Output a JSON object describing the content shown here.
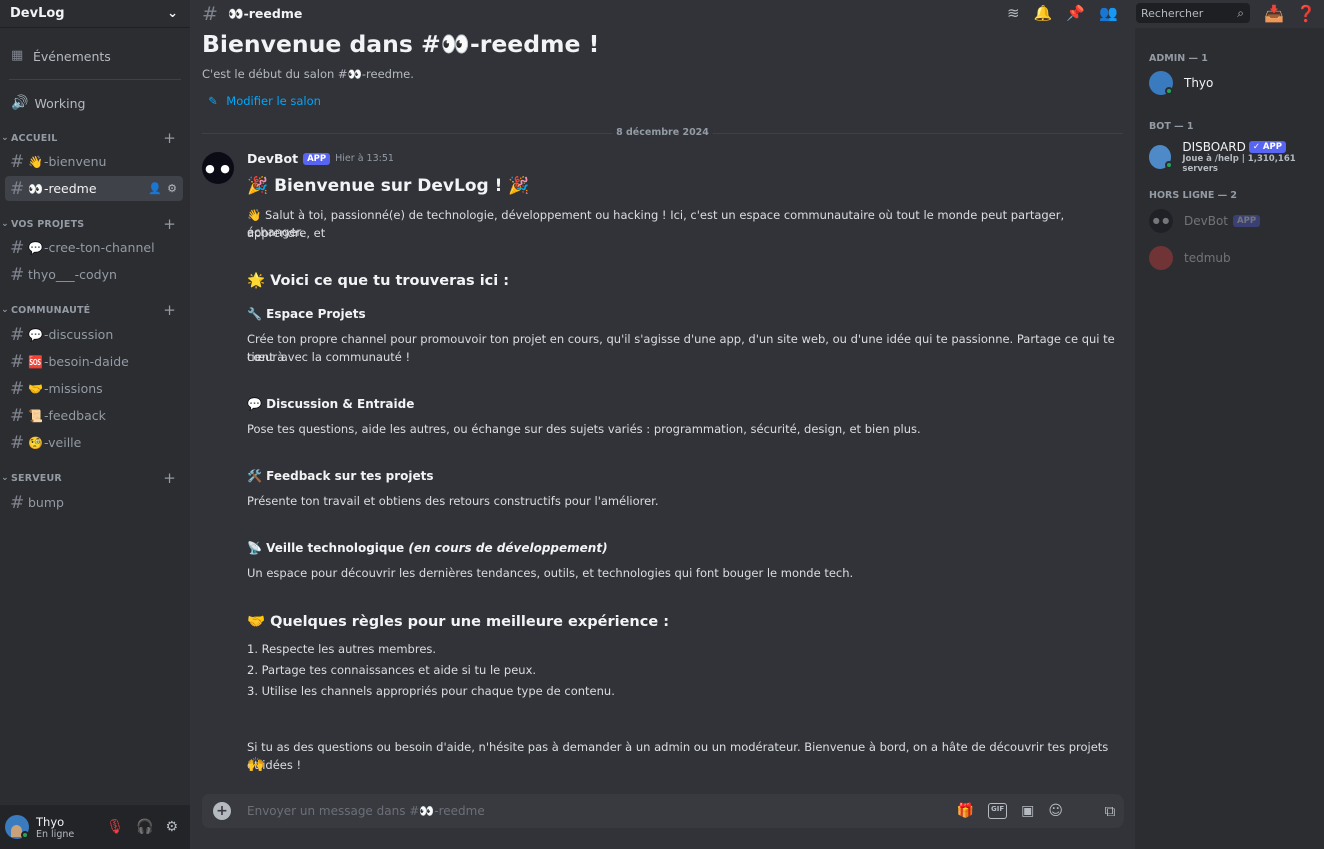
{
  "server": {
    "name": "DevLog"
  },
  "sidebar": {
    "events_label": "Événements",
    "working_label": "Working",
    "categories": [
      {
        "name": "ACCUEIL",
        "channels": [
          {
            "emoji": "👋",
            "name": "-bienvenu"
          },
          {
            "emoji": "👀",
            "name": "-reedme"
          }
        ]
      },
      {
        "name": "VOS PROJETS",
        "channels": [
          {
            "emoji": "💬",
            "name": "-cree-ton-channel"
          },
          {
            "emoji": "",
            "name": "thyo___-codyn"
          }
        ]
      },
      {
        "name": "COMMUNAUTÉ",
        "channels": [
          {
            "emoji": "💬",
            "name": "-discussion"
          },
          {
            "emoji": "🆘",
            "name": "-besoin-daide"
          },
          {
            "emoji": "🤝",
            "name": "-missions"
          },
          {
            "emoji": "📜",
            "name": "-feedback"
          },
          {
            "emoji": "🧐",
            "name": "-veille"
          }
        ]
      },
      {
        "name": "SERVEUR",
        "channels": [
          {
            "emoji": "",
            "name": "bump"
          }
        ]
      }
    ]
  },
  "user": {
    "name": "Thyo",
    "status": "En ligne"
  },
  "channel": {
    "name": "👀-reedme"
  },
  "search": {
    "placeholder": "Rechercher"
  },
  "welcome": {
    "title": "Bienvenue dans #👀-reedme !",
    "subtitle": "C'est le début du salon #👀-reedme.",
    "edit_label": "Modifier le salon"
  },
  "date_divider": "8 décembre 2024",
  "message": {
    "author": "DevBot",
    "badge": "APP",
    "time": "Hier à 13:51",
    "title": "🎉 Bienvenue sur DevLog ! 🎉",
    "intro_line1": "👋 Salut à toi, passionné(e) de technologie, développement ou hacking ! Ici, c'est un espace communautaire où tout le monde peut partager, apprendre, et",
    "intro_line2": "échanger.",
    "section1": "🌟 Voici ce que tu trouveras ici :",
    "projets_title": "🔧 Espace Projets",
    "projets_line1": "Crée ton propre channel pour promouvoir ton projet en cours, qu'il s'agisse d'une app, d'un site web, ou d'une idée qui te passionne. Partage ce qui te tient à",
    "projets_line2": "cœur avec la communauté !",
    "discussion_title": "💬 Discussion & Entraide",
    "discussion_text": "Pose tes questions, aide les autres, ou échange sur des sujets variés : programmation, sécurité, design, et bien plus.",
    "feedback_title": "🛠️ Feedback sur tes projets",
    "feedback_text": "Présente ton travail et obtiens des retours constructifs pour l'améliorer.",
    "veille_title": "📡 Veille technologique",
    "veille_note": "(en cours de développement)",
    "veille_text": "Un espace pour découvrir les dernières tendances, outils, et technologies qui font bouger le monde tech.",
    "section2": "🤝 Quelques règles pour une meilleure expérience :",
    "rule1": "1. Respecte les autres membres.",
    "rule2": "2. Partage tes connaissances et aide si tu le peux.",
    "rule3": "3. Utilise les channels appropriés pour chaque type de contenu.",
    "outro": "Si tu as des questions ou besoin d'aide, n'hésite pas à demander à un admin ou un modérateur. Bienvenue à bord, on a hâte de découvrir tes projets et idées !",
    "outro_emoji": "🙌"
  },
  "composer": {
    "placeholder": "Envoyer un message dans #👀-reedme",
    "gif": "GIF"
  },
  "members": {
    "admin_header": "ADMIN — 1",
    "admin": [
      {
        "name": "Thyo"
      }
    ],
    "bot_header": "BOT — 1",
    "bots": [
      {
        "name": "DISBOARD",
        "badge": "✓ APP",
        "activity": "Joue à /help | 1,310,161 servers"
      }
    ],
    "offline_header": "HORS LIGNE — 2",
    "offline": [
      {
        "name": "DevBot",
        "badge": "APP"
      },
      {
        "name": "tedmub"
      }
    ]
  },
  "colors": {
    "accent": "#5865f2",
    "link": "#00a8fc",
    "online": "#23a55a",
    "danger": "#f23f42"
  }
}
